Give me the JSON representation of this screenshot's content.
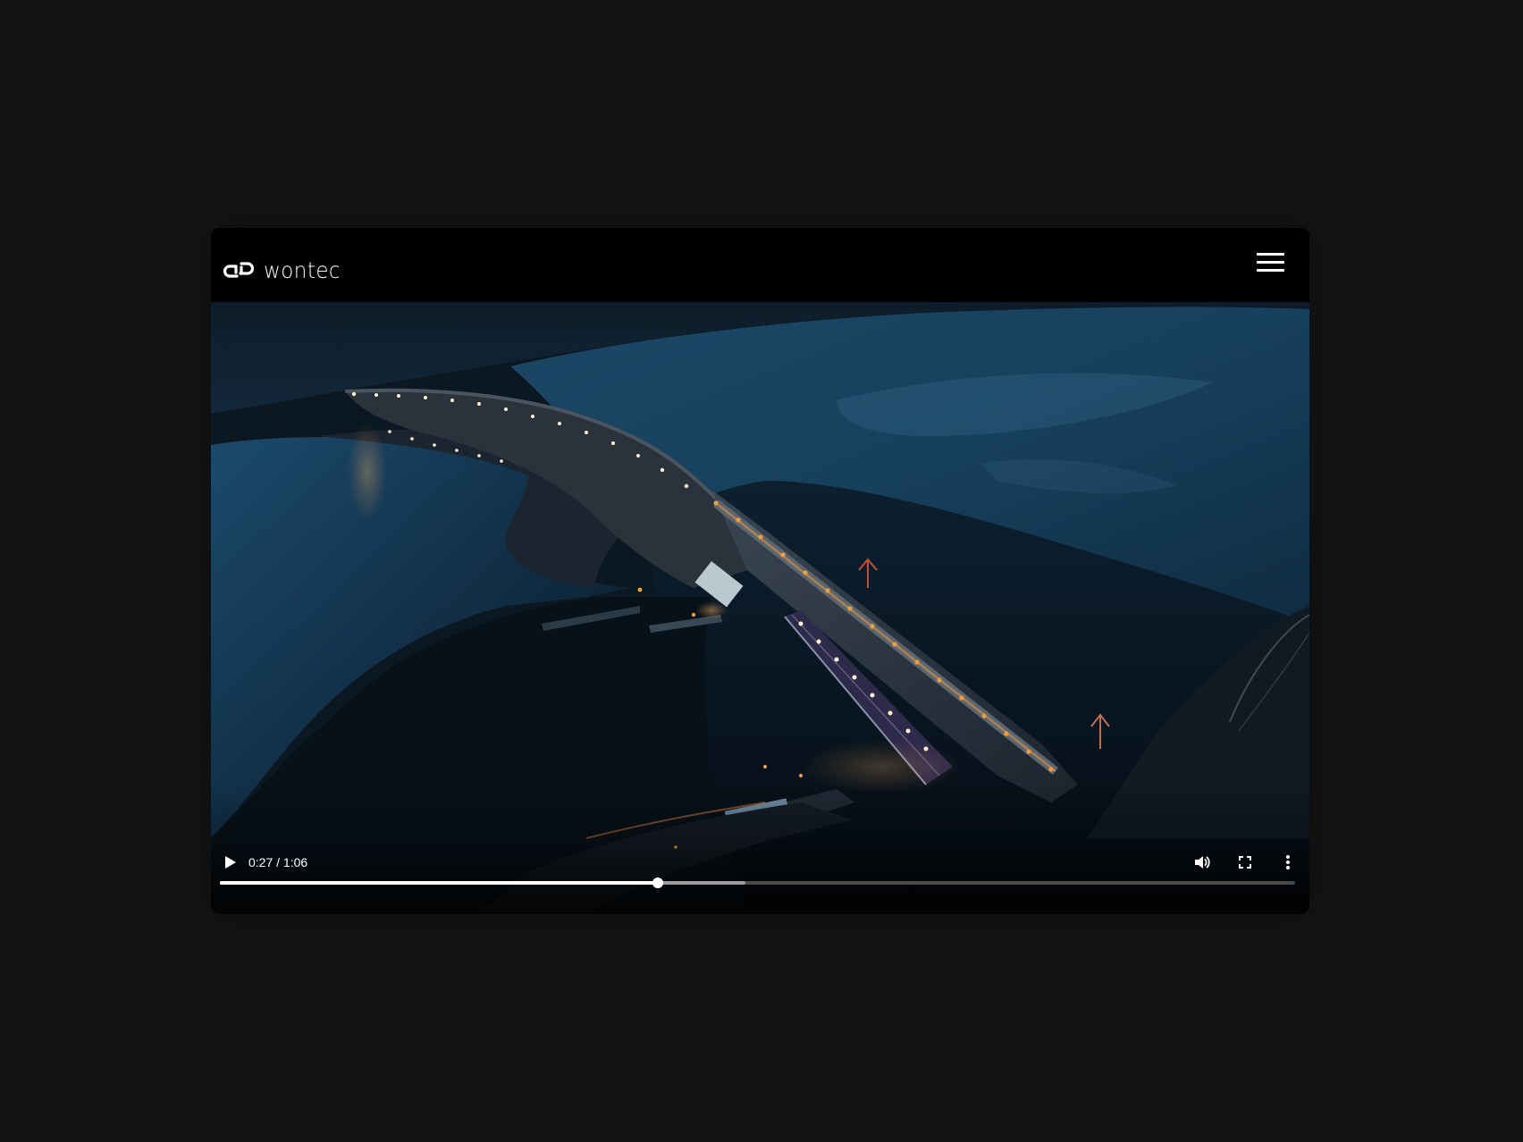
{
  "brand": {
    "name": "wontec",
    "logo_icon": "chain-link-logo-icon"
  },
  "header": {
    "menu_icon": "hamburger-menu-icon"
  },
  "video": {
    "scene": "aerial view of hydroelectric dam at dusk",
    "current_time": "0:27",
    "separator": " / ",
    "duration": "1:06",
    "progress_fraction": 0.407,
    "buffered_fraction": 0.489,
    "controls": {
      "play_icon": "play-icon",
      "volume_icon": "volume-icon",
      "fullscreen_icon": "fullscreen-icon",
      "more_icon": "more-options-icon"
    }
  },
  "colors": {
    "page_background": "#141414",
    "frame_background": "#000000",
    "water": "#1b4a6b",
    "lights": "#f0a040",
    "controls": "#ffffff"
  }
}
